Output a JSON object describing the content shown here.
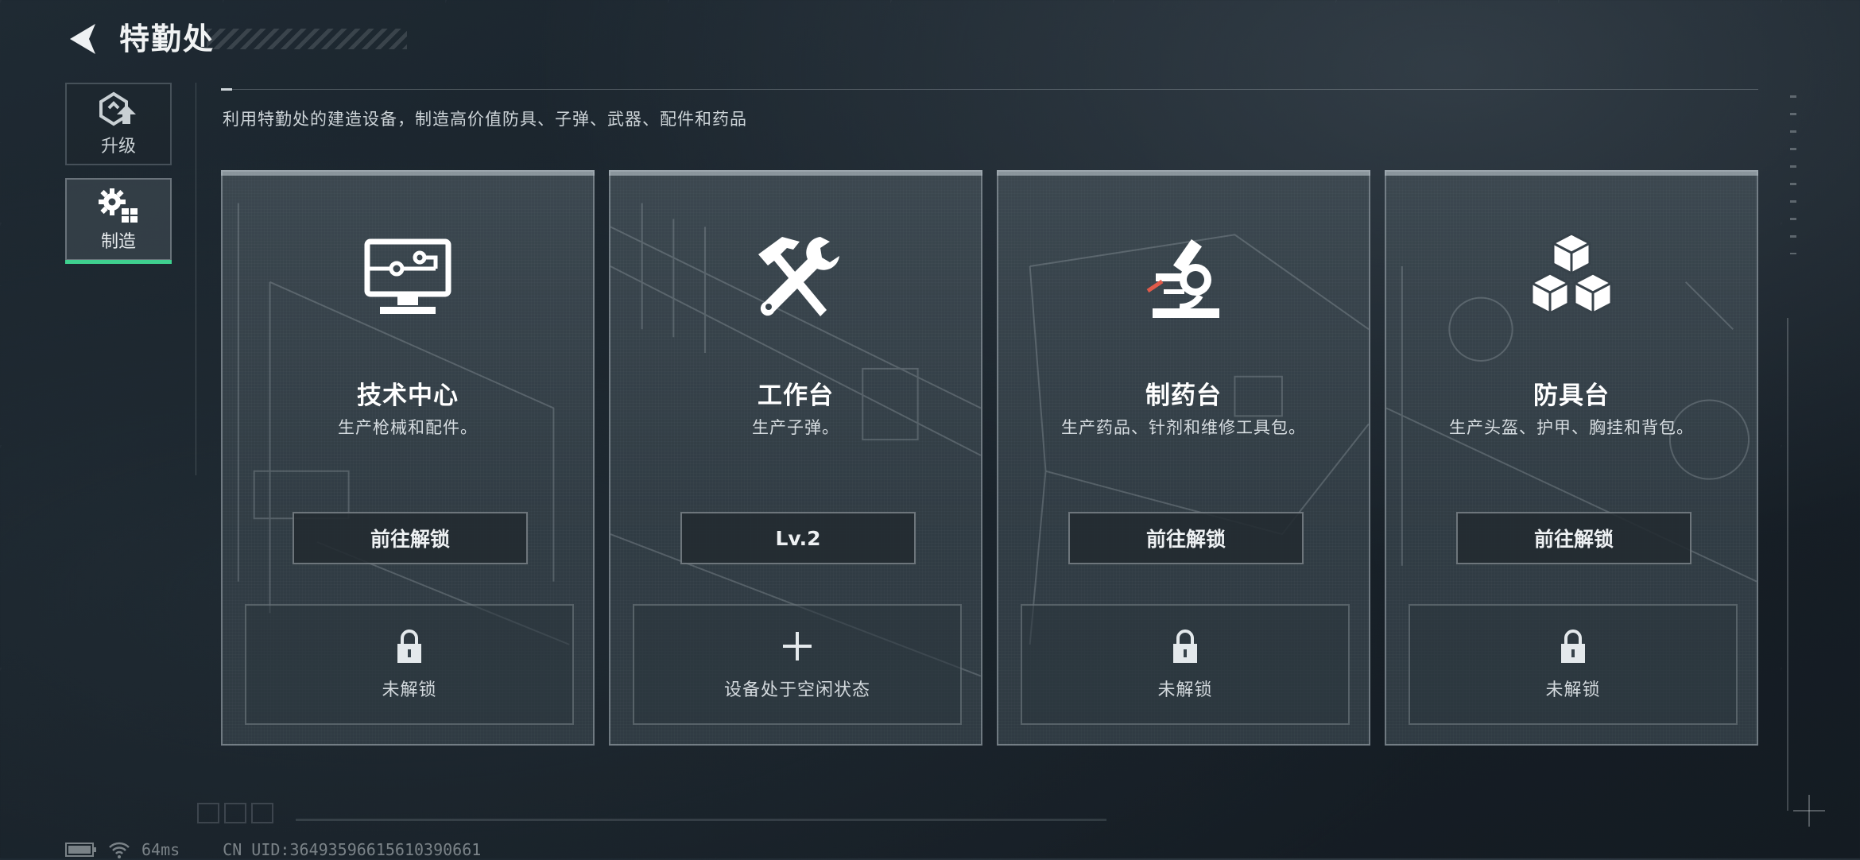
{
  "header": {
    "title": "特勤处"
  },
  "sidebar": {
    "tabs": [
      {
        "label": "升级",
        "icon": "upgrade-icon",
        "active": false
      },
      {
        "label": "制造",
        "icon": "gears-icon",
        "active": true
      }
    ]
  },
  "description": "利用特勤处的建造设备，制造高价值防具、子弹、武器、配件和药品",
  "cards": [
    {
      "title": "技术中心",
      "subtitle": "生产枪械和配件。",
      "icon": "monitor-icon",
      "button": "前往解锁",
      "slot_text": "未解锁",
      "slot_icon": "lock-icon"
    },
    {
      "title": "工作台",
      "subtitle": "生产子弹。",
      "icon": "hammer-wrench-icon",
      "button": "Lv.2",
      "slot_text": "设备处于空闲状态",
      "slot_icon": "plus-icon"
    },
    {
      "title": "制药台",
      "subtitle": "生产药品、针剂和维修工具包。",
      "icon": "microscope-icon",
      "button": "前往解锁",
      "slot_text": "未解锁",
      "slot_icon": "lock-icon"
    },
    {
      "title": "防具台",
      "subtitle": "生产头盔、护甲、胸挂和背包。",
      "icon": "cubes-icon",
      "button": "前往解锁",
      "slot_text": "未解锁",
      "slot_icon": "lock-icon"
    }
  ],
  "status_bar": {
    "ping": "64ms",
    "uid": "CN UID:36493596615610390661"
  },
  "colors": {
    "accent": "#3fd08f",
    "background": "#182129"
  }
}
